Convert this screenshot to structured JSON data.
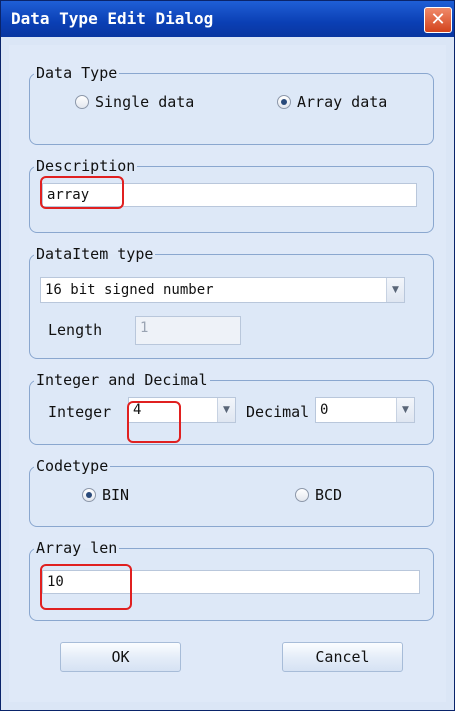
{
  "window": {
    "title": "Data Type Edit Dialog",
    "close_glyph": "✕"
  },
  "data_type": {
    "legend": "Data Type",
    "options": [
      {
        "label": "Single data",
        "selected": false
      },
      {
        "label": "Array data",
        "selected": true
      }
    ]
  },
  "description": {
    "legend": "Description",
    "value": "array"
  },
  "data_item_type": {
    "legend": "DataItem type",
    "selected": "16 bit signed number",
    "length_label": "Length",
    "length_value": "1"
  },
  "integer_decimal": {
    "legend": "Integer and Decimal",
    "integer_label": "Integer",
    "integer_value": "4",
    "decimal_label": "Decimal",
    "decimal_value": "0"
  },
  "code_type": {
    "legend": "Codetype",
    "options": [
      {
        "label": "BIN",
        "selected": true
      },
      {
        "label": "BCD",
        "selected": false
      }
    ]
  },
  "array_len": {
    "legend": "Array len",
    "value": "10"
  },
  "buttons": {
    "ok": "OK",
    "cancel": "Cancel"
  },
  "colors": {
    "highlight": "#e02020",
    "titlebar": "#0a3fb4"
  },
  "icons": {
    "combo_arrow": "chevron-down-icon",
    "close": "close-icon"
  }
}
